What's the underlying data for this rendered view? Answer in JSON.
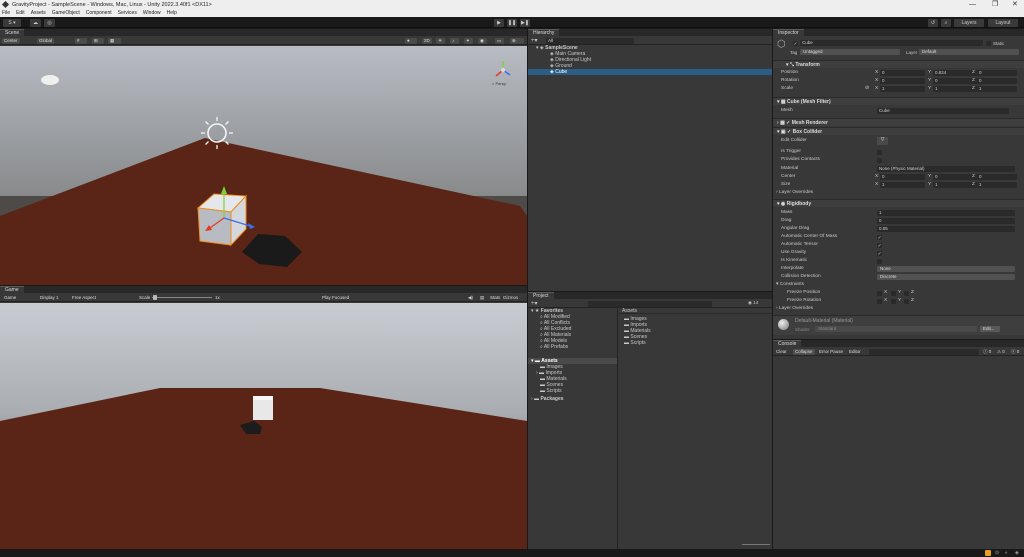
{
  "window": {
    "title": "GravityProject - SampleScene - Windows, Mac, Linux - Unity 2022.3.40f1 <DX11>",
    "controls": [
      "—",
      "❐",
      "✕"
    ]
  },
  "menu": [
    "File",
    "Edit",
    "Assets",
    "GameObject",
    "Component",
    "Services",
    "Window",
    "Help"
  ],
  "toolbar": {
    "account": "S ▾",
    "play": "▶",
    "pause": "❚❚",
    "step": "▶❚",
    "layers": "Layers",
    "layout": "Layout"
  },
  "scene": {
    "tab": "Scene",
    "pivot": "Center",
    "space": "Global",
    "mode": "2D",
    "persp": "< Persp"
  },
  "game": {
    "tab": "Game",
    "display_mode": "Game",
    "display": "Display 1",
    "aspect": "Free Aspect",
    "scale_label": "Scale",
    "scale_value": "1x",
    "play_focused": "Play Focused",
    "gizmos": "Gizmos"
  },
  "hierarchy": {
    "tab": "Hierarchy",
    "search": "All",
    "scene": "SampleScene",
    "items": [
      "Main Camera",
      "Directional Light",
      "Ground",
      "Cube"
    ],
    "selected": "Cube"
  },
  "project": {
    "tab": "Project",
    "count": "14",
    "favorites_label": "Favorites",
    "favorites": [
      "All Modified",
      "All Conflicts",
      "All Excluded",
      "All Materials",
      "All Models",
      "All Prefabs"
    ],
    "assets_label": "Assets",
    "assets": [
      "Images",
      "Imports",
      "Materials",
      "Scenes",
      "Scripts"
    ],
    "packages_label": "Packages",
    "right_header": "Assets",
    "right_items": [
      "Images",
      "Imports",
      "Materials",
      "Scenes",
      "Scripts"
    ]
  },
  "inspector": {
    "tab": "Inspector",
    "name": "Cube",
    "static": "Static",
    "tag_label": "Tag",
    "tag": "Untagged",
    "layer_label": "Layer",
    "layer": "Default",
    "transform": {
      "title": "Transform",
      "position": {
        "label": "Position",
        "x": "0",
        "y": "0.824",
        "z": "0"
      },
      "rotation": {
        "label": "Rotation",
        "x": "0",
        "y": "0",
        "z": "0"
      },
      "scale": {
        "label": "Scale",
        "x": "1",
        "y": "1",
        "z": "1"
      }
    },
    "mesh_filter": {
      "title": "Cube (Mesh Filter)",
      "mesh_label": "Mesh",
      "mesh": "Cube"
    },
    "mesh_renderer": {
      "title": "Mesh Renderer"
    },
    "box_collider": {
      "title": "Box Collider",
      "edit_label": "Edit Collider",
      "is_trigger": "Is Trigger",
      "provides_contacts": "Provides Contacts",
      "material_label": "Material",
      "material": "None (Physic Material)",
      "center": {
        "label": "Center",
        "x": "0",
        "y": "0",
        "z": "0"
      },
      "size": {
        "label": "Size",
        "x": "1",
        "y": "1",
        "z": "1"
      },
      "layer_overrides": "Layer Overrides"
    },
    "rigidbody": {
      "title": "Rigidbody",
      "mass_label": "Mass",
      "mass": "1",
      "drag_label": "Drag",
      "drag": "0",
      "angular_drag_label": "Angular Drag",
      "angular_drag": "0.05",
      "auto_com": "Automatic Center Of Mass",
      "auto_tensor": "Automatic Tensor",
      "use_gravity": "Use Gravity",
      "is_kinematic": "Is Kinematic",
      "interpolate_label": "Interpolate",
      "interpolate": "None",
      "collision_label": "Collision Detection",
      "collision": "Discrete",
      "constraints": "Constraints",
      "freeze_pos": "Freeze Position",
      "freeze_rot": "Freeze Rotation",
      "layer_overrides": "Layer Overrides"
    },
    "material": {
      "title": "Default-Material (Material)",
      "shader_label": "Shader",
      "shader": "Standard",
      "edit": "Edit..."
    }
  },
  "console": {
    "tab": "Console",
    "clear": "Clear",
    "collapse": "Collapse",
    "error_pause": "Error Pause",
    "editor": "Editor",
    "counts": [
      "0",
      "0",
      "0"
    ]
  },
  "colors": {
    "panel": "#383838",
    "selection": "#2c5d87",
    "ground": "#5a2416",
    "sky": "#c8ccd2"
  }
}
